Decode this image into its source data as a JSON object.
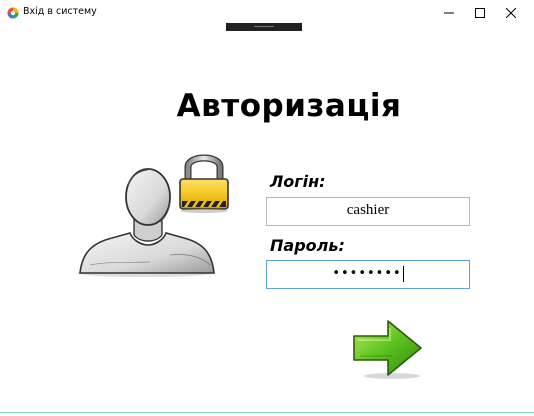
{
  "window": {
    "title": "Вхід в систему",
    "controls": {
      "minimize": "minimize",
      "maximize": "maximize",
      "close": "close"
    }
  },
  "main": {
    "heading": "Авторизація",
    "login_label": "Логін:",
    "login_value": "cashier",
    "password_label": "Пароль:",
    "password_masked": "••••••••"
  },
  "icons": {
    "app": "app-logo-icon",
    "user": "user-silhouette-icon",
    "lock": "padlock-icon",
    "submit": "green-arrow-right-icon"
  },
  "colors": {
    "focus_border": "#5fa3d6",
    "lock_yellow": "#f2c21a",
    "arrow_green": "#5cc21f"
  }
}
